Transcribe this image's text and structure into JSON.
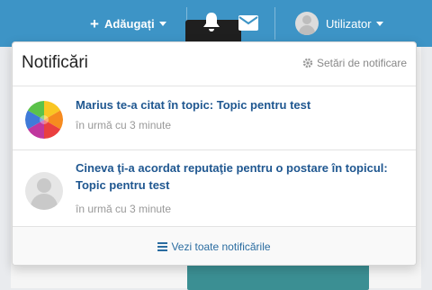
{
  "navbar": {
    "add_label": "Adăugați",
    "user_label": "Utilizator",
    "icons": {
      "add": "plus-icon",
      "notifications": "bell-icon",
      "messages": "envelope-icon",
      "user": "avatar-icon"
    },
    "colors": {
      "bar": "#3d94c6",
      "active_tab": "#1f1f1f"
    }
  },
  "notifications": {
    "title": "Notificări",
    "settings_label": "Setări de notificare",
    "items": [
      {
        "text": "Marius te-a citat în topic: Topic pentru test",
        "time": "în urmă cu 3 minute",
        "avatar": "color-wheel-avatar"
      },
      {
        "text": "Cineva ţi-a acordat reputaţie pentru o postare în topicul: Topic pentru test",
        "time": "în urmă cu 3 minute",
        "avatar": "default-user-avatar"
      }
    ],
    "footer_label": "Vezi toate notificările",
    "colors": {
      "link": "#1f5790",
      "muted": "#999999"
    }
  }
}
